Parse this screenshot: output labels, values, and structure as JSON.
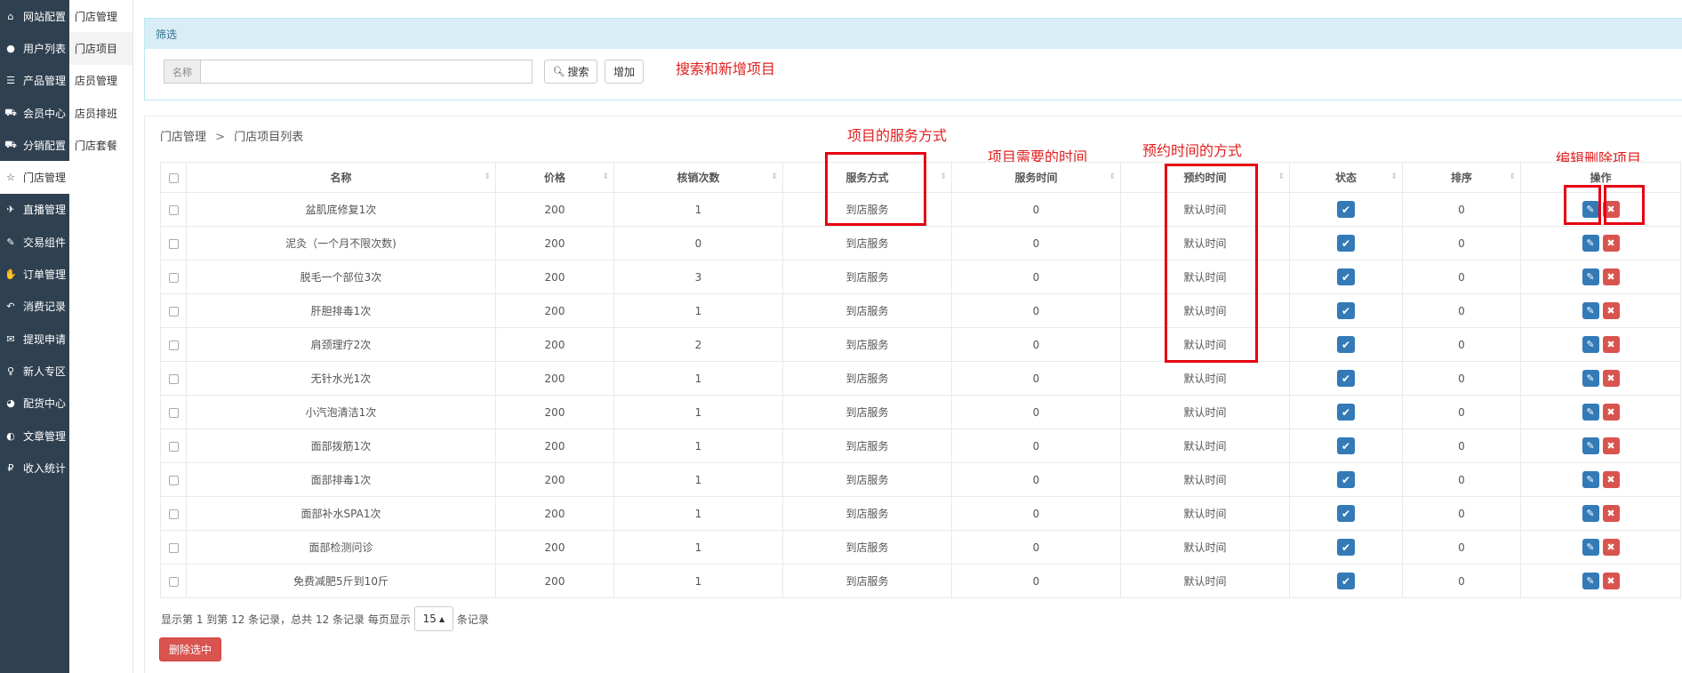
{
  "sidebar": {
    "items": [
      {
        "label": "网站配置",
        "icon": "home-icon",
        "glyph": "⌂"
      },
      {
        "label": "用户列表",
        "icon": "user-icon",
        "glyph": "●"
      },
      {
        "label": "产品管理",
        "icon": "list-icon",
        "glyph": "☰"
      },
      {
        "label": "会员中心",
        "icon": "cart-icon",
        "glyph": "⛟"
      },
      {
        "label": "分销配置",
        "icon": "cart-icon",
        "glyph": "⛟"
      },
      {
        "label": "门店管理",
        "icon": "star-icon",
        "glyph": "☆"
      },
      {
        "label": "直播管理",
        "icon": "plane-icon",
        "glyph": "✈"
      },
      {
        "label": "交易组件",
        "icon": "eraser-icon",
        "glyph": "✎"
      },
      {
        "label": "订单管理",
        "icon": "thumbs-up-icon",
        "glyph": "✋"
      },
      {
        "label": "消费记录",
        "icon": "reply-icon",
        "glyph": "↶"
      },
      {
        "label": "提现申请",
        "icon": "wechat-icon",
        "glyph": "✉"
      },
      {
        "label": "新人专区",
        "icon": "map-pin-icon",
        "glyph": "♀"
      },
      {
        "label": "配货中心",
        "icon": "pie-chart-icon",
        "glyph": "◕"
      },
      {
        "label": "文章管理",
        "icon": "adjust-icon",
        "glyph": "◐"
      },
      {
        "label": "收入统计",
        "icon": "ruble-icon",
        "glyph": "₽"
      }
    ],
    "active_index": 5
  },
  "submenu": {
    "items": [
      "门店管理",
      "门店项目",
      "店员管理",
      "店员排班",
      "门店套餐"
    ],
    "active_index": 1
  },
  "filter": {
    "heading": "筛选",
    "name_label": "名称",
    "name_value": "",
    "search_label": "搜索",
    "add_label": "增加"
  },
  "breadcrumb": {
    "parent": "门店管理",
    "separator": ">",
    "current": "门店项目列表"
  },
  "table": {
    "headers": [
      "名称",
      "价格",
      "核销次数",
      "服务方式",
      "服务时间",
      "预约时间",
      "状态",
      "排序",
      "操作"
    ],
    "rows": [
      {
        "name": "盆肌底修复1次",
        "price": "200",
        "count": "1",
        "service": "到店服务",
        "service_time": "0",
        "booking": "默认时间",
        "sort": "0"
      },
      {
        "name": "泥灸（一个月不限次数)",
        "price": "200",
        "count": "0",
        "service": "到店服务",
        "service_time": "0",
        "booking": "默认时间",
        "sort": "0"
      },
      {
        "name": "脱毛一个部位3次",
        "price": "200",
        "count": "3",
        "service": "到店服务",
        "service_time": "0",
        "booking": "默认时间",
        "sort": "0"
      },
      {
        "name": "肝胆排毒1次",
        "price": "200",
        "count": "1",
        "service": "到店服务",
        "service_time": "0",
        "booking": "默认时间",
        "sort": "0"
      },
      {
        "name": "肩颈理疗2次",
        "price": "200",
        "count": "2",
        "service": "到店服务",
        "service_time": "0",
        "booking": "默认时间",
        "sort": "0"
      },
      {
        "name": "无针水光1次",
        "price": "200",
        "count": "1",
        "service": "到店服务",
        "service_time": "0",
        "booking": "默认时间",
        "sort": "0"
      },
      {
        "name": "小汽泡清洁1次",
        "price": "200",
        "count": "1",
        "service": "到店服务",
        "service_time": "0",
        "booking": "默认时间",
        "sort": "0"
      },
      {
        "name": "面部拨筋1次",
        "price": "200",
        "count": "1",
        "service": "到店服务",
        "service_time": "0",
        "booking": "默认时间",
        "sort": "0"
      },
      {
        "name": "面部排毒1次",
        "price": "200",
        "count": "1",
        "service": "到店服务",
        "service_time": "0",
        "booking": "默认时间",
        "sort": "0"
      },
      {
        "name": "面部补水SPA1次",
        "price": "200",
        "count": "1",
        "service": "到店服务",
        "service_time": "0",
        "booking": "默认时间",
        "sort": "0"
      },
      {
        "name": "面部检测问诊",
        "price": "200",
        "count": "1",
        "service": "到店服务",
        "service_time": "0",
        "booking": "默认时间",
        "sort": "0"
      },
      {
        "name": "免费减肥5斤到10斤",
        "price": "200",
        "count": "1",
        "service": "到店服务",
        "service_time": "0",
        "booking": "默认时间",
        "sort": "0"
      }
    ]
  },
  "footer": {
    "info_text": "显示第 1 到第 12 条记录，总共 12 条记录 每页显示",
    "page_size": "15",
    "suffix": "条记录",
    "delete_selected_label": "删除选中"
  },
  "annotations": {
    "search_add": "搜索和新增项目",
    "service_mode": "项目的服务方式",
    "service_time": "项目需要的时间",
    "booking_mode": "预约时间的方式",
    "edit_delete": "编辑删除项目"
  },
  "colors": {
    "sidebar_bg": "#2f4050",
    "filter_head_bg": "#d9edf7",
    "primary": "#337ab7",
    "danger": "#d9534f",
    "annotation": "#e02020"
  }
}
